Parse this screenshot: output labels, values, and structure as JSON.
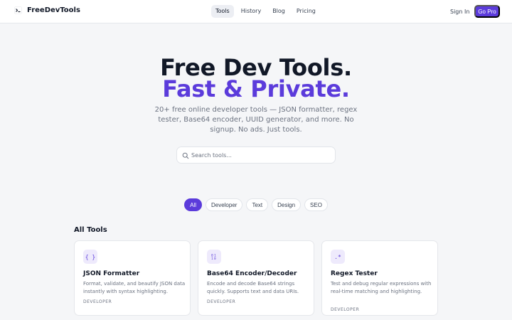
{
  "header": {
    "logo_mark": "⌘",
    "brand": "FreeDevTools",
    "nav": [
      {
        "label": "Tools",
        "active": true
      },
      {
        "label": "History",
        "active": false
      },
      {
        "label": "Blog",
        "active": false
      },
      {
        "label": "Pricing",
        "active": false
      }
    ],
    "sign_in": "Sign In",
    "go_pro": "Go Pro"
  },
  "hero": {
    "title_line1": "Free Dev Tools.",
    "title_line2": "Fast & Private.",
    "subtitle": "20+ free online developer tools — JSON formatter, regex tester, Base64 encoder, UUID generator, and more. No signup. No ads. Just tools."
  },
  "search": {
    "placeholder": "Search tools...",
    "value": ""
  },
  "filters": [
    {
      "label": "All",
      "active": true
    },
    {
      "label": "Developer",
      "active": false
    },
    {
      "label": "Text",
      "active": false
    },
    {
      "label": "Design",
      "active": false
    },
    {
      "label": "SEO",
      "active": false
    }
  ],
  "section_title": "All Tools",
  "cards": [
    {
      "icon": "{ }",
      "icon_name": "braces-icon",
      "title": "JSON Formatter",
      "description": "Format, validate, and beautify JSON data instantly with syntax highlighting.",
      "tag": "DEVELOPER"
    },
    {
      "icon": "01",
      "icon_name": "binary-icon",
      "title": "Base64 Encoder/Decoder",
      "description": "Encode and decode Base64 strings quickly. Supports text and data URIs.",
      "tag": "DEVELOPER"
    },
    {
      "icon": ".*",
      "icon_name": "regex-icon",
      "title": "Regex Tester",
      "description": "Test and debug regular expressions with real-time matching and highlighting.",
      "tag": "DEVELOPER"
    }
  ],
  "colors": {
    "accent": "#5b3bdb",
    "background": "#f5f6f8"
  }
}
